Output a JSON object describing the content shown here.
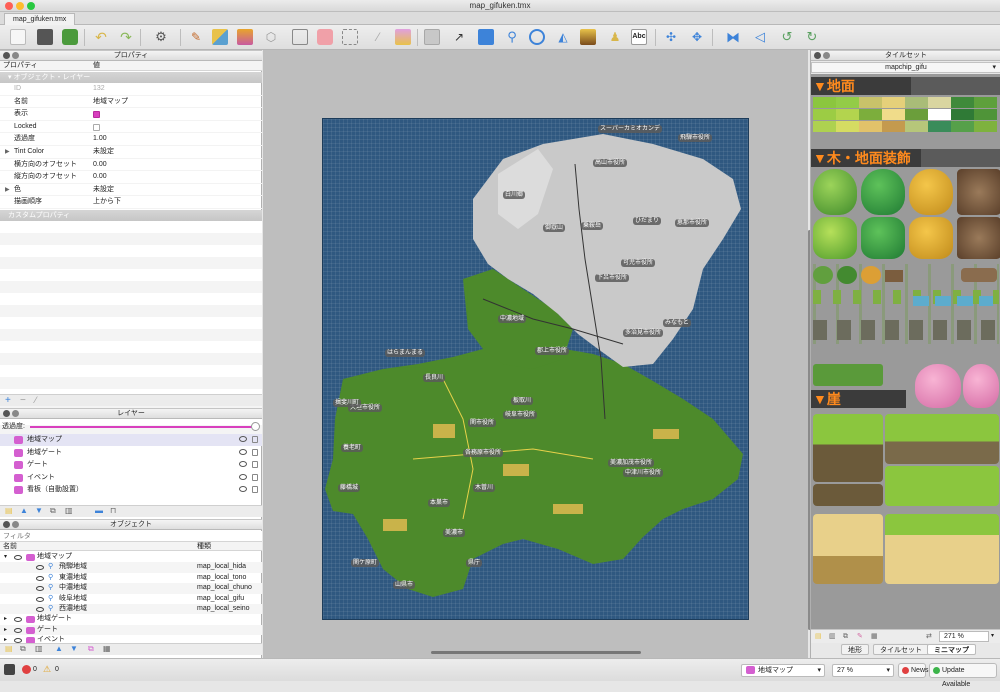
{
  "window": {
    "title": "map_gifuken.tmx",
    "tab": "map_gifuken.tmx"
  },
  "properties": {
    "panel_title": "プロパティ",
    "col_property": "プロパティ",
    "col_value": "値",
    "group_object_layer": "オブジェクト・レイヤー",
    "rows": [
      {
        "key": "ID",
        "value": "132",
        "muted": true
      },
      {
        "key": "名前",
        "value": "地域マップ"
      },
      {
        "key": "表示",
        "value": "",
        "check": "on"
      },
      {
        "key": "Locked",
        "value": "",
        "check": "off"
      },
      {
        "key": "透過度",
        "value": "1.00"
      },
      {
        "key": "Tint Color",
        "value": "未設定",
        "arrow": true
      },
      {
        "key": "横方向のオフセット",
        "value": "0.00"
      },
      {
        "key": "縦方向のオフセット",
        "value": "0.00"
      },
      {
        "key": "色",
        "value": "未設定",
        "arrow": true
      },
      {
        "key": "描画順序",
        "value": "上から下"
      }
    ],
    "group_custom": "カスタムプロパティ"
  },
  "layers": {
    "panel_title": "レイヤー",
    "opacity_label": "透過度:",
    "items": [
      "地域マップ",
      "地域ゲート",
      "ゲート",
      "イベント",
      "看板（自動設置）"
    ]
  },
  "objects": {
    "panel_title": "オブジェクト",
    "filter_placeholder": "フィルタ",
    "col_name": "名前",
    "col_type": "種類",
    "rows": [
      {
        "name": "地域マップ",
        "type": "",
        "indent": 0,
        "layer": true
      },
      {
        "name": "飛騨地域",
        "type": "map_local_hida",
        "indent": 2
      },
      {
        "name": "東濃地域",
        "type": "map_local_tono",
        "indent": 2
      },
      {
        "name": "中濃地域",
        "type": "map_local_chuno",
        "indent": 2
      },
      {
        "name": "岐阜地域",
        "type": "map_local_gifu",
        "indent": 2
      },
      {
        "name": "西濃地域",
        "type": "map_local_seino",
        "indent": 2
      },
      {
        "name": "地域ゲート",
        "type": "",
        "indent": 0,
        "layer": true
      },
      {
        "name": "ゲート",
        "type": "",
        "indent": 0,
        "layer": true
      },
      {
        "name": "イベント",
        "type": "",
        "indent": 0,
        "layer": true
      }
    ]
  },
  "map_labels": [
    "スーパーカミオカンデ",
    "飛騨市役所",
    "高山市役所",
    "下呂市役所",
    "郡上市役所",
    "中濃地域",
    "白川郷",
    "御嶽山",
    "乗鞍岳",
    "ひだまり",
    "恵那市役所",
    "多治見市役所",
    "可児市役所",
    "大垣市役所",
    "岐阜市役所",
    "関市役所",
    "各務原市役所",
    "美濃加茂市役所",
    "中津川市役所",
    "揖斐川町",
    "養老町",
    "関ケ原町",
    "長良川",
    "木曽川",
    "みなもと",
    "はらまんまる",
    "県庁",
    "藤橋城",
    "板取川",
    "美濃市",
    "本巣市",
    "山県市"
  ],
  "tileset": {
    "panel_title": "タイルセット",
    "name": "mapchip_gifu",
    "sections": [
      "▼地面",
      "▼木・地面装飾",
      "▼崖"
    ],
    "zoom": "271 %",
    "tabs": [
      "地形",
      "タイルセット",
      "ミニマップ"
    ]
  },
  "status": {
    "errors": "0",
    "warnings": "0",
    "layer_select": "地域マップ",
    "zoom": "27 %",
    "news": "News",
    "update": "Update Available"
  },
  "colors": {
    "accent": "#d83fbe",
    "water": "#2f5880",
    "land": "#4d8a2b",
    "mountain": "#c9c9c9",
    "tile_header": "#ff8a1d"
  }
}
